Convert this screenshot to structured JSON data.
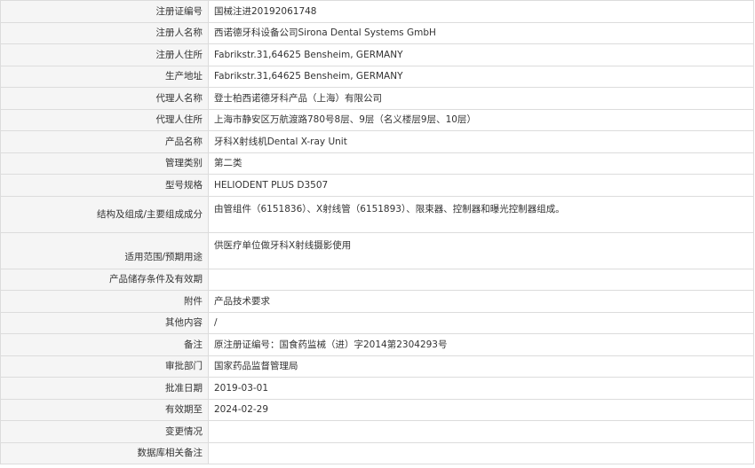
{
  "rows": [
    {
      "label": "注册证编号",
      "value": "国械注进20192061748"
    },
    {
      "label": "注册人名称",
      "value": "西诺德牙科设备公司Sirona Dental Systems GmbH"
    },
    {
      "label": "注册人住所",
      "value": "Fabrikstr.31,64625 Bensheim, GERMANY"
    },
    {
      "label": "生产地址",
      "value": "Fabrikstr.31,64625 Bensheim, GERMANY"
    },
    {
      "label": "代理人名称",
      "value": "登士柏西诺德牙科产品（上海）有限公司"
    },
    {
      "label": "代理人住所",
      "value": "上海市静安区万航渡路780号8层、9层（名义楼层9层、10层）"
    },
    {
      "label": "产品名称",
      "value": "牙科X射线机Dental X-ray Unit"
    },
    {
      "label": "管理类别",
      "value": "第二类"
    },
    {
      "label": "型号规格",
      "value": "HELIODENT PLUS D3507"
    },
    {
      "label": "结构及组成/主要组成成分",
      "value": "由管组件（6151836）、X射线管（6151893）、限束器、控制器和曝光控制器组成。"
    },
    {
      "label": "适用范围/预期用途",
      "value": "供医疗单位做牙科X射线摄影使用"
    },
    {
      "label": "产品储存条件及有效期",
      "value": ""
    },
    {
      "label": "附件",
      "value": "产品技术要求"
    },
    {
      "label": "其他内容",
      "value": "/"
    },
    {
      "label": "备注",
      "value": "原注册证编号：国食药监械（进）字2014第2304293号"
    },
    {
      "label": "审批部门",
      "value": "国家药品监督管理局"
    },
    {
      "label": "批准日期",
      "value": "2019-03-01"
    },
    {
      "label": "有效期至",
      "value": "2024-02-29"
    },
    {
      "label": "变更情况",
      "value": ""
    },
    {
      "label": "数据库相关备注",
      "value": ""
    }
  ]
}
